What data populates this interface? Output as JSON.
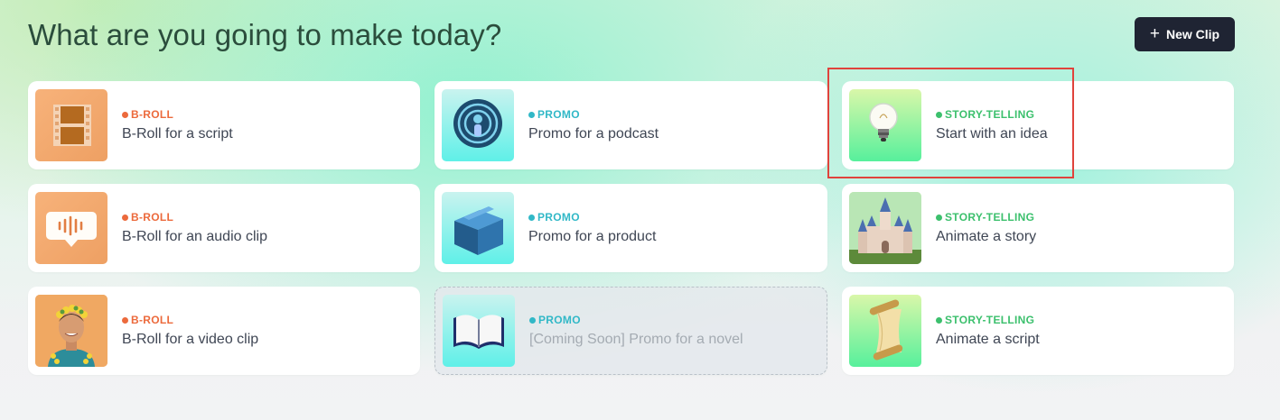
{
  "header": {
    "title": "What are you going to make today?",
    "new_clip_label": "New Clip"
  },
  "colors": {
    "broll": "#ec6a3c",
    "promo": "#31b8c7",
    "story": "#3cc06d",
    "button_bg": "#1f2433",
    "highlight": "#e0433c"
  },
  "cards": [
    {
      "tag": "B-ROLL",
      "title": "B-Roll for a script",
      "icon": "film-strip-icon"
    },
    {
      "tag": "PROMO",
      "title": "Promo for a podcast",
      "icon": "podcast-icon"
    },
    {
      "tag": "STORY-TELLING",
      "title": "Start with an idea",
      "icon": "lightbulb-icon"
    },
    {
      "tag": "B-ROLL",
      "title": "B-Roll for an audio clip",
      "icon": "audio-message-icon"
    },
    {
      "tag": "PROMO",
      "title": "Promo for a product",
      "icon": "box-icon"
    },
    {
      "tag": "STORY-TELLING",
      "title": "Animate a story",
      "icon": "castle-icon"
    },
    {
      "tag": "B-ROLL",
      "title": "B-Roll for a video clip",
      "icon": "person-portrait-icon"
    },
    {
      "tag": "PROMO",
      "title": "[Coming Soon] Promo for a novel",
      "icon": "open-book-icon",
      "disabled": true
    },
    {
      "tag": "STORY-TELLING",
      "title": "Animate a script",
      "icon": "scroll-icon"
    }
  ]
}
